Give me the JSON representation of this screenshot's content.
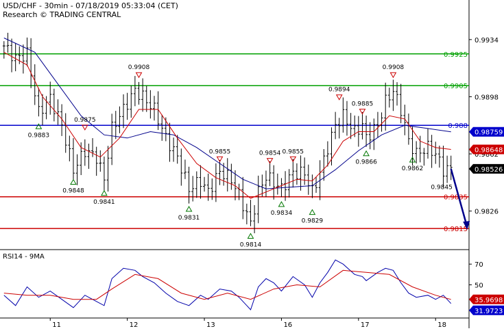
{
  "header": {
    "title": "USD/CHF - 30min - 07/18/2019 05:33:04 (CET)",
    "subtitle": "Research © TRADING CENTRAL"
  },
  "colors": {
    "support": "#cc0000",
    "resistance": "#00a000",
    "pivot": "#0000cc",
    "price": "#000000",
    "ma_fast": "#cc0000",
    "ma_slow": "#00008b",
    "rsi": "#0000aa",
    "rsi_ma": "#cc0000",
    "marker_high": "#cc0000",
    "marker_low": "#007700",
    "arrow": "#00008b",
    "price_tag": "#000000",
    "ma_tag_fast": "#cc0000",
    "ma_tag_slow": "#0000cc"
  },
  "chart_data": [
    {
      "type": "line",
      "title": "USD/CHF - 30min",
      "x_ticks": [
        "11",
        "12",
        "13",
        "16",
        "17",
        "18"
      ],
      "y_ticks": [
        0.9934,
        0.9898,
        0.9862,
        0.9826
      ],
      "ylim": [
        0.9803,
        0.9946
      ],
      "horizontal_levels": [
        {
          "label": "0.9925",
          "value": 0.9925,
          "color": "resistance"
        },
        {
          "label": "0.9905",
          "value": 0.9905,
          "color": "resistance"
        },
        {
          "label": "0.988",
          "value": 0.988,
          "color": "pivot"
        },
        {
          "label": "0.9835",
          "value": 0.9835,
          "color": "support"
        },
        {
          "label": "0.9815",
          "value": 0.9815,
          "color": "support"
        }
      ],
      "price_tags": [
        {
          "label": "0.98759",
          "value": 0.98759,
          "color": "ma_tag_slow"
        },
        {
          "label": "0.98648",
          "value": 0.98648,
          "color": "ma_tag_fast"
        },
        {
          "label": "0.98526",
          "value": 0.98526,
          "color": "price_tag"
        }
      ],
      "annotations": [
        {
          "label": "0.9908",
          "value": 0.9908,
          "kind": "high",
          "bar": 35
        },
        {
          "label": "0.9908",
          "value": 0.9908,
          "kind": "high",
          "bar": 101
        },
        {
          "label": "0.9894",
          "value": 0.9894,
          "kind": "high",
          "bar": 87
        },
        {
          "label": "0.9885",
          "value": 0.9885,
          "kind": "high",
          "bar": 93
        },
        {
          "label": "0.9875",
          "value": 0.9875,
          "kind": "high",
          "bar": 21
        },
        {
          "label": "0.9855",
          "value": 0.9855,
          "kind": "high",
          "bar": 56
        },
        {
          "label": "0.9854",
          "value": 0.9854,
          "kind": "high",
          "bar": 69
        },
        {
          "label": "0.9855",
          "value": 0.9855,
          "kind": "high",
          "bar": 75
        },
        {
          "label": "0.9883",
          "value": 0.9883,
          "kind": "low",
          "bar": 9
        },
        {
          "label": "0.9848",
          "value": 0.9848,
          "kind": "low",
          "bar": 18
        },
        {
          "label": "0.9841",
          "value": 0.9841,
          "kind": "low",
          "bar": 26
        },
        {
          "label": "0.9831",
          "value": 0.9831,
          "kind": "low",
          "bar": 48
        },
        {
          "label": "0.9814",
          "value": 0.9814,
          "kind": "low",
          "bar": 64
        },
        {
          "label": "0.9834",
          "value": 0.9834,
          "kind": "low",
          "bar": 72
        },
        {
          "label": "0.9829",
          "value": 0.9829,
          "kind": "low",
          "bar": 80
        },
        {
          "label": "0.9866",
          "value": 0.9866,
          "kind": "low",
          "bar": 94
        },
        {
          "label": "0.9862",
          "value": 0.9862,
          "kind": "low",
          "bar": 106
        },
        {
          "label": "0.9845",
          "value": 0.9845,
          "kind": "target",
          "bar": 115
        }
      ],
      "bars": 117,
      "close_path": [
        [
          0,
          0.993
        ],
        [
          3,
          0.9922
        ],
        [
          6,
          0.9925
        ],
        [
          9,
          0.9888
        ],
        [
          12,
          0.9897
        ],
        [
          15,
          0.988
        ],
        [
          18,
          0.9852
        ],
        [
          21,
          0.9864
        ],
        [
          24,
          0.986
        ],
        [
          26,
          0.9846
        ],
        [
          28,
          0.9878
        ],
        [
          31,
          0.989
        ],
        [
          34,
          0.9902
        ],
        [
          36,
          0.9898
        ],
        [
          39,
          0.989
        ],
        [
          42,
          0.9872
        ],
        [
          45,
          0.986
        ],
        [
          48,
          0.984
        ],
        [
          51,
          0.9845
        ],
        [
          53,
          0.9838
        ],
        [
          56,
          0.9851
        ],
        [
          59,
          0.9846
        ],
        [
          61,
          0.9836
        ],
        [
          63,
          0.9824
        ],
        [
          64,
          0.9818
        ],
        [
          66,
          0.9838
        ],
        [
          68,
          0.9848
        ],
        [
          70,
          0.9844
        ],
        [
          72,
          0.984
        ],
        [
          75,
          0.985
        ],
        [
          78,
          0.985
        ],
        [
          80,
          0.9838
        ],
        [
          82,
          0.985
        ],
        [
          84,
          0.9866
        ],
        [
          86,
          0.988
        ],
        [
          88,
          0.9886
        ],
        [
          91,
          0.9876
        ],
        [
          93,
          0.988
        ],
        [
          94,
          0.9872
        ],
        [
          97,
          0.988
        ],
        [
          99,
          0.9895
        ],
        [
          101,
          0.9902
        ],
        [
          103,
          0.989
        ],
        [
          105,
          0.987
        ],
        [
          107,
          0.9862
        ],
        [
          110,
          0.9866
        ],
        [
          112,
          0.9862
        ],
        [
          114,
          0.9852
        ],
        [
          116,
          0.98526
        ]
      ],
      "projection": {
        "from": [
          116,
          0.98526
        ],
        "to": [
          120,
          0.9815
        ]
      },
      "ma_fast_path": [
        [
          0,
          0.9926
        ],
        [
          6,
          0.9918
        ],
        [
          10,
          0.9898
        ],
        [
          15,
          0.9884
        ],
        [
          20,
          0.9866
        ],
        [
          25,
          0.986
        ],
        [
          30,
          0.9872
        ],
        [
          35,
          0.989
        ],
        [
          40,
          0.989
        ],
        [
          45,
          0.9872
        ],
        [
          50,
          0.9856
        ],
        [
          55,
          0.9847
        ],
        [
          60,
          0.9842
        ],
        [
          64,
          0.9834
        ],
        [
          68,
          0.9838
        ],
        [
          72,
          0.9842
        ],
        [
          76,
          0.9846
        ],
        [
          80,
          0.9845
        ],
        [
          84,
          0.9855
        ],
        [
          88,
          0.987
        ],
        [
          92,
          0.9876
        ],
        [
          96,
          0.9876
        ],
        [
          100,
          0.9886
        ],
        [
          104,
          0.9884
        ],
        [
          108,
          0.987
        ],
        [
          112,
          0.9866
        ],
        [
          116,
          0.98648
        ]
      ],
      "ma_slow_path": [
        [
          0,
          0.9935
        ],
        [
          8,
          0.9926
        ],
        [
          14,
          0.9906
        ],
        [
          20,
          0.9886
        ],
        [
          26,
          0.9874
        ],
        [
          32,
          0.9872
        ],
        [
          38,
          0.9876
        ],
        [
          44,
          0.9874
        ],
        [
          50,
          0.9866
        ],
        [
          56,
          0.9856
        ],
        [
          62,
          0.9846
        ],
        [
          68,
          0.984
        ],
        [
          74,
          0.9841
        ],
        [
          80,
          0.9842
        ],
        [
          86,
          0.9852
        ],
        [
          92,
          0.9864
        ],
        [
          98,
          0.9874
        ],
        [
          104,
          0.988
        ],
        [
          110,
          0.9878
        ],
        [
          116,
          0.98759
        ]
      ]
    },
    {
      "type": "line",
      "title": "RSI14 - 9MA",
      "y_ticks": [
        70,
        50
      ],
      "ylim": [
        18,
        82
      ],
      "price_tags": [
        {
          "label": "35.9698",
          "value": 35.9698,
          "color": "ma_tag_fast"
        },
        {
          "label": "31.9723",
          "value": 31.9723,
          "color": "ma_tag_slow"
        }
      ],
      "series": [
        {
          "color": "rsi",
          "values": [
            [
              0,
              40
            ],
            [
              3,
              30
            ],
            [
              6,
              48
            ],
            [
              9,
              38
            ],
            [
              12,
              44
            ],
            [
              15,
              36
            ],
            [
              18,
              28
            ],
            [
              21,
              40
            ],
            [
              24,
              34
            ],
            [
              26,
              30
            ],
            [
              28,
              56
            ],
            [
              31,
              66
            ],
            [
              34,
              64
            ],
            [
              36,
              58
            ],
            [
              39,
              52
            ],
            [
              42,
              42
            ],
            [
              45,
              34
            ],
            [
              48,
              30
            ],
            [
              51,
              40
            ],
            [
              53,
              36
            ],
            [
              56,
              46
            ],
            [
              59,
              44
            ],
            [
              61,
              38
            ],
            [
              63,
              30
            ],
            [
              64,
              26
            ],
            [
              66,
              48
            ],
            [
              68,
              56
            ],
            [
              70,
              52
            ],
            [
              72,
              44
            ],
            [
              75,
              58
            ],
            [
              78,
              50
            ],
            [
              80,
              38
            ],
            [
              82,
              52
            ],
            [
              84,
              62
            ],
            [
              86,
              74
            ],
            [
              88,
              70
            ],
            [
              91,
              60
            ],
            [
              93,
              58
            ],
            [
              94,
              54
            ],
            [
              97,
              62
            ],
            [
              99,
              66
            ],
            [
              101,
              64
            ],
            [
              103,
              52
            ],
            [
              105,
              42
            ],
            [
              107,
              38
            ],
            [
              110,
              40
            ],
            [
              112,
              36
            ],
            [
              114,
              40
            ],
            [
              116,
              31.9723
            ]
          ]
        },
        {
          "color": "rsi_ma",
          "values": [
            [
              0,
              42
            ],
            [
              6,
              40
            ],
            [
              12,
              40
            ],
            [
              18,
              36
            ],
            [
              24,
              36
            ],
            [
              28,
              46
            ],
            [
              34,
              60
            ],
            [
              40,
              56
            ],
            [
              46,
              42
            ],
            [
              52,
              36
            ],
            [
              58,
              42
            ],
            [
              64,
              36
            ],
            [
              70,
              46
            ],
            [
              76,
              50
            ],
            [
              82,
              48
            ],
            [
              88,
              64
            ],
            [
              94,
              62
            ],
            [
              100,
              60
            ],
            [
              106,
              48
            ],
            [
              112,
              40
            ],
            [
              116,
              35.9698
            ]
          ]
        }
      ]
    }
  ]
}
